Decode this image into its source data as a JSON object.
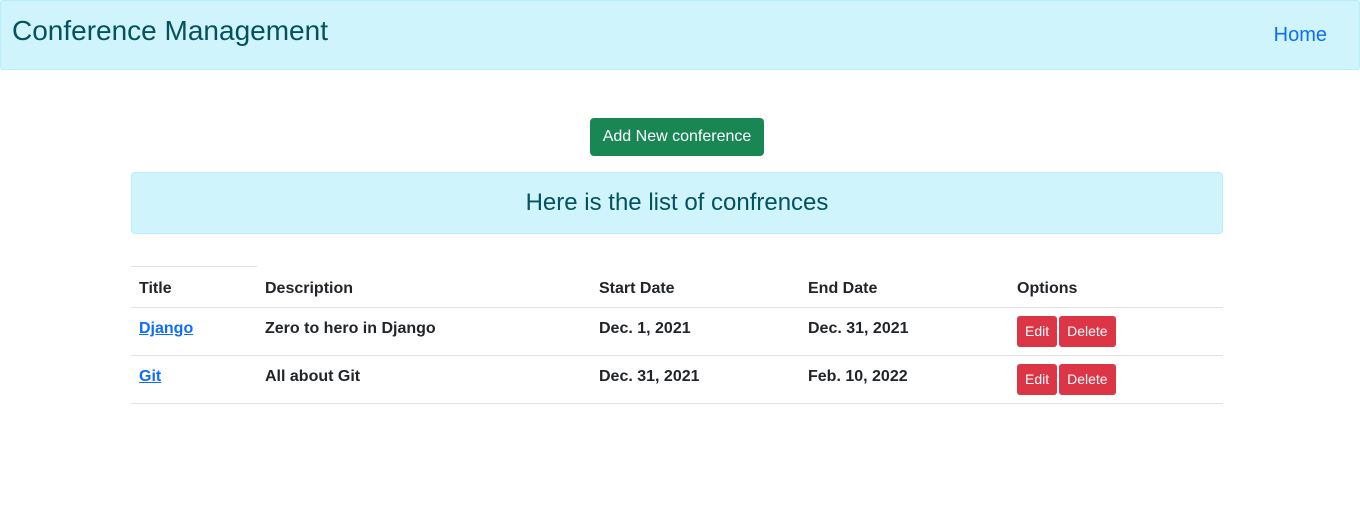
{
  "navbar": {
    "brand": "Conference Management",
    "home_label": "Home"
  },
  "actions": {
    "add_label": "Add New conference"
  },
  "alert": {
    "text": "Here is the list of confrences"
  },
  "table": {
    "headers": [
      "Title",
      "Description",
      "Start Date",
      "End Date",
      "Options"
    ],
    "rows": [
      {
        "title": "Django",
        "description": "Zero to hero in Django",
        "start_date": "Dec. 1, 2021",
        "end_date": "Dec. 31, 2021",
        "edit_label": "Edit",
        "delete_label": "Delete"
      },
      {
        "title": "Git",
        "description": "All about Git",
        "start_date": "Dec. 31, 2021",
        "end_date": "Feb. 10, 2022",
        "edit_label": "Edit",
        "delete_label": "Delete"
      }
    ]
  },
  "colors": {
    "navbar_bg": "#cff4fc",
    "brand_text": "#055160",
    "link": "#0d6efd",
    "success": "#198754",
    "danger": "#dc3545"
  }
}
